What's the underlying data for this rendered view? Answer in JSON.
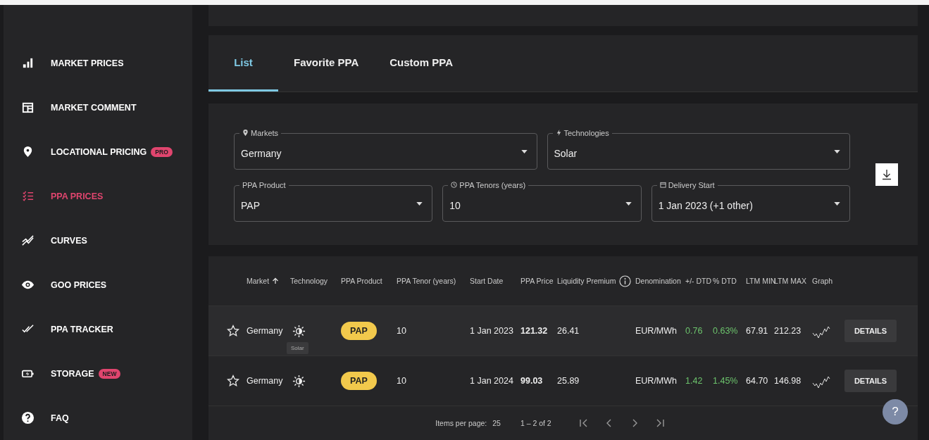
{
  "sidebar": {
    "items": [
      {
        "label": "MARKET PRICES",
        "selected": false
      },
      {
        "label": "MARKET COMMENT",
        "selected": false
      },
      {
        "label": "LOCATIONAL PRICING",
        "badge": "PRO",
        "selected": false
      },
      {
        "label": "PPA PRICES",
        "selected": true
      },
      {
        "label": "CURVES",
        "selected": false
      },
      {
        "label": "GOO PRICES",
        "selected": false
      },
      {
        "label": "PPA TRACKER",
        "selected": false
      },
      {
        "label": "STORAGE",
        "badge": "NEW",
        "selected": false
      },
      {
        "label": "FAQ",
        "selected": false
      }
    ]
  },
  "tabs": [
    {
      "label": "List",
      "selected": true
    },
    {
      "label": "Favorite PPA",
      "selected": false
    },
    {
      "label": "Custom PPA",
      "selected": false
    }
  ],
  "filters": [
    {
      "label": "Markets",
      "value": "Germany"
    },
    {
      "label": "Technologies",
      "value": "Solar"
    },
    {
      "label": "PPA Product",
      "value": "PAP"
    },
    {
      "label": "PPA Tenors (years)",
      "value": "10"
    },
    {
      "label": "Delivery Start",
      "value": "1 Jan 2023 (+1 other)"
    }
  ],
  "table": {
    "columns": [
      "Market",
      "Technology",
      "PPA Product",
      "PPA Tenor (years)",
      "Start Date",
      "PPA Price",
      "Liquidity Premium",
      "Denomination",
      "+/- DTD",
      "% DTD",
      "LTM MIN",
      "LTM MAX",
      "Graph"
    ],
    "rows": [
      {
        "favorite": false,
        "market": "Germany",
        "tooltip": "Solar",
        "product": "PAP",
        "tenor": "10",
        "start": "1 Jan 2023",
        "price": "121.32",
        "liquidity": "26.41",
        "denomination": "EUR/MWh",
        "dtd": "0.76",
        "pct_dtd": "0.63%",
        "ltm_min": "67.91",
        "ltm_max": "212.23",
        "action": "DETAILS"
      },
      {
        "favorite": false,
        "market": "Germany",
        "product": "PAP",
        "tenor": "10",
        "start": "1 Jan 2024",
        "price": "99.03",
        "liquidity": "25.89",
        "denomination": "EUR/MWh",
        "dtd": "1.42",
        "pct_dtd": "1.45%",
        "ltm_min": "64.70",
        "ltm_max": "146.98",
        "action": "DETAILS"
      }
    ]
  },
  "pagination": {
    "items_per_page_label": "Items per page:",
    "items_per_page": "25",
    "range": "1 – 2 of 2"
  },
  "help_button": "?"
}
